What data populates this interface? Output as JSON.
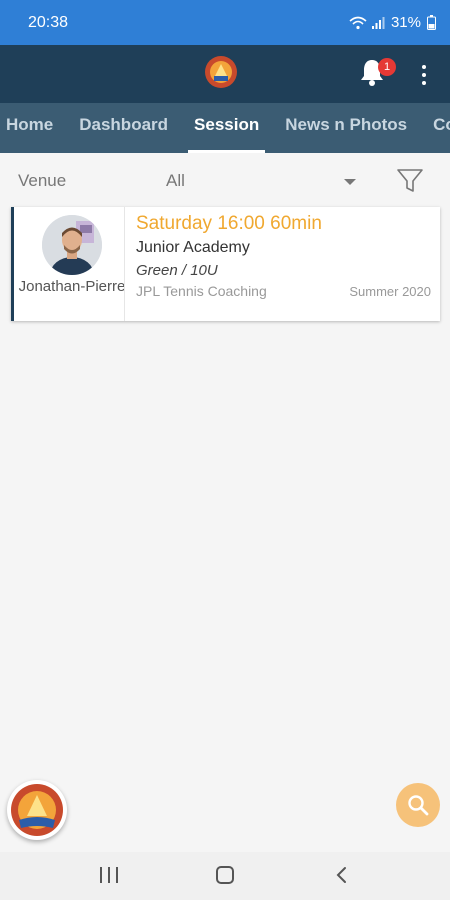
{
  "status_bar": {
    "time": "20:38",
    "battery": "31%",
    "icons": [
      "wifi-icon",
      "signal-icon",
      "battery-icon"
    ]
  },
  "app_bar": {
    "logo": "club-logo-icon",
    "notification_count": "1",
    "icons": [
      "bell-icon",
      "more-vert-icon"
    ]
  },
  "tabs": [
    {
      "label": "Home",
      "active": false
    },
    {
      "label": "Dashboard",
      "active": false
    },
    {
      "label": "Session",
      "active": true
    },
    {
      "label": "News n Photos",
      "active": false
    },
    {
      "label": "Co",
      "active": false
    }
  ],
  "filter": {
    "label": "Venue",
    "value": "All",
    "icons": [
      "dropdown-arrow-icon",
      "filter-icon"
    ]
  },
  "session_card": {
    "coach_name": "Jonathan-Pierre",
    "time": "Saturday 16:00 60min",
    "title": "Junior Academy",
    "level": "Green / 10U",
    "venue": "JPL Tennis Coaching",
    "term": "Summer 2020"
  },
  "fabs": {
    "logo": "club-logo-icon",
    "search": "search-icon"
  },
  "nav": {
    "icons": [
      "recent-apps-icon",
      "home-icon",
      "back-icon"
    ]
  },
  "colors": {
    "status_bar": "#2f7fd6",
    "app_bar": "#1f3f58",
    "tabs_bg": "#3b5c73",
    "accent": "#f0a830",
    "badge": "#e53935"
  }
}
